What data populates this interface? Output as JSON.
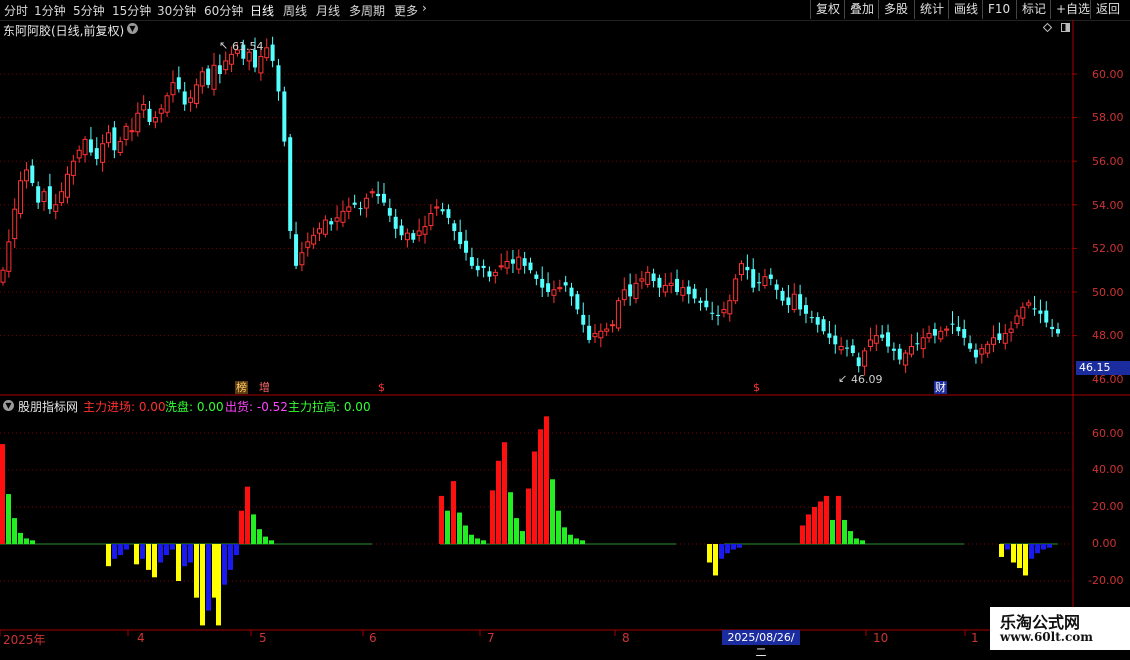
{
  "toolbar": {
    "periods": [
      "分时",
      "1分钟",
      "5分钟",
      "15分钟",
      "30分钟",
      "60分钟",
      "日线",
      "周线",
      "月线",
      "多周期",
      "更多"
    ],
    "active_period": "日线",
    "more_icon": "chevron-right-icon",
    "right_buttons": [
      "复权",
      "叠加",
      "多股",
      "统计",
      "画线",
      "F10",
      "标记",
      "+自选",
      "返回"
    ]
  },
  "main_chart": {
    "title": "东阿阿胶(日线,前复权)",
    "collapse_icon": "chevron-down-icon",
    "high_label": "61.54",
    "low_label": "46.09",
    "current_price": "46.15",
    "y_ticks": [
      "60.00",
      "58.00",
      "56.00",
      "54.00",
      "52.00",
      "50.00",
      "48.00",
      "46.00"
    ],
    "markers": [
      {
        "text": "榜",
        "color": "#ffcc66",
        "bg": "#5a3a10"
      },
      {
        "text": "增",
        "color": "#ff6666",
        "bg": "#000000"
      },
      {
        "text": "$",
        "color": "#ff3333",
        "bg": "#000000"
      },
      {
        "text": "$",
        "color": "#ff3333",
        "bg": "#000000"
      },
      {
        "text": "财",
        "color": "#ffffff",
        "bg": "#1b2d9e"
      }
    ]
  },
  "indicator": {
    "collapse_icon": "chevron-down-icon",
    "name": "股朋指标网",
    "legend": [
      {
        "label": "主力进场: 0.00",
        "color": "#ff3030"
      },
      {
        "label": "洗盘: 0.00",
        "color": "#33ff33"
      },
      {
        "label": "出货: -0.52",
        "color": "#ff44ff"
      },
      {
        "label": "主力拉高: 0.00",
        "color": "#33ff33"
      }
    ],
    "y_ticks": [
      "60.00",
      "40.00",
      "20.00",
      "0.00",
      "-20.00"
    ]
  },
  "x_axis": {
    "labels": [
      "2025年",
      "4",
      "5",
      "6",
      "7",
      "8",
      "10",
      "1"
    ],
    "cursor_date": "2025/08/26/二"
  },
  "watermark": {
    "line1": "乐淘公式网",
    "line2": "www.60lt.com"
  },
  "chart_data": {
    "type": "candlestick",
    "colors": {
      "up": "#ff3333",
      "down": "#54ffff",
      "grid": "#7a0000"
    },
    "price_ylim": [
      46,
      62
    ],
    "closes": [
      51.0,
      52.3,
      53.8,
      55.1,
      55.6,
      55.0,
      54.1,
      54.6,
      53.8,
      54.0,
      54.6,
      55.4,
      56.0,
      56.5,
      57.0,
      56.4,
      56.1,
      56.8,
      57.3,
      56.5,
      56.9,
      57.6,
      57.4,
      58.2,
      58.6,
      57.8,
      58.0,
      58.4,
      59.0,
      59.6,
      59.3,
      58.6,
      58.9,
      59.5,
      60.1,
      59.5,
      60.4,
      60.0,
      60.6,
      60.9,
      61.1,
      60.7,
      61.0,
      60.3,
      60.8,
      61.2,
      60.6,
      59.2,
      56.9,
      52.8,
      51.2,
      51.8,
      52.3,
      52.6,
      52.9,
      53.3,
      53.1,
      53.4,
      53.7,
      53.9,
      54.0,
      53.8,
      54.3,
      54.6,
      54.4,
      54.1,
      53.5,
      52.9,
      52.6,
      52.7,
      52.4,
      52.8,
      53.0,
      53.6,
      53.9,
      53.7,
      53.4,
      52.8,
      52.2,
      51.8,
      51.2,
      51.0,
      51.1,
      50.7,
      50.9,
      51.2,
      51.4,
      51.3,
      51.6,
      51.2,
      51.0,
      50.6,
      50.2,
      50.0,
      50.1,
      50.2,
      50.3,
      49.8,
      49.2,
      48.5,
      47.8,
      48.1,
      48.2,
      48.3,
      48.5,
      49.6,
      50.1,
      49.8,
      50.4,
      50.6,
      50.9,
      50.5,
      50.2,
      50.3,
      50.4,
      50.0,
      50.2,
      49.9,
      49.7,
      49.5,
      49.3,
      49.0,
      48.9,
      49.2,
      49.6,
      50.6,
      51.3,
      51.0,
      50.2,
      50.4,
      50.7,
      50.6,
      50.1,
      49.6,
      49.4,
      49.9,
      49.2,
      49.0,
      48.8,
      48.5,
      48.2,
      47.9,
      47.6,
      47.5,
      47.4,
      47.2,
      46.6,
      47.3,
      47.8,
      48.0,
      47.9,
      47.5,
      47.3,
      46.9,
      47.2,
      47.5,
      47.6,
      47.9,
      48.1,
      48.0,
      48.2,
      48.3,
      48.5,
      48.2,
      47.9,
      47.4,
      47.0,
      47.4,
      47.6,
      47.9,
      47.8,
      48.1,
      48.3,
      48.9,
      49.3,
      49.5,
      49.2,
      49.0,
      48.6,
      48.3,
      48.1
    ]
  }
}
